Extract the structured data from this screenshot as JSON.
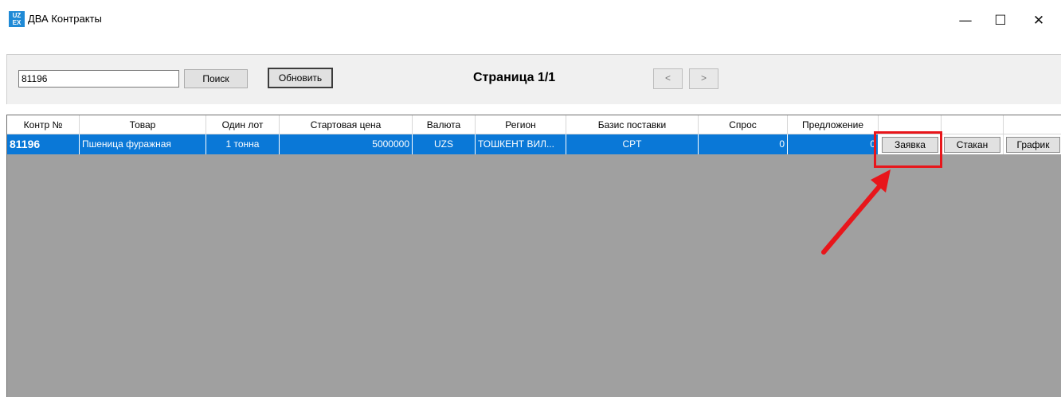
{
  "window": {
    "icon_top": "UZ",
    "icon_bottom": "EX",
    "title": "ДВА Контракты",
    "minimize": "—",
    "maximize": "☐",
    "close": "✕"
  },
  "toolbar": {
    "search_value": "81196",
    "search_label": "Поиск",
    "refresh_label": "Обновить",
    "page_label": "Страница 1/1",
    "prev_label": "<",
    "next_label": ">"
  },
  "table": {
    "headers": [
      "Контр №",
      "Товар",
      "Один лот",
      "Стартовая цена",
      "Валюта",
      "Регион",
      "Базис поставки",
      "Спрос",
      "Предложение",
      "",
      "",
      ""
    ],
    "row": {
      "contract_no": "81196",
      "product": "Пшеница фуражная",
      "lot": "1 тонна",
      "start_price": "5000000",
      "currency": "UZS",
      "region": "ТОШКЕНТ ВИЛ...",
      "delivery_basis": "CPT",
      "demand": "0",
      "offer": "0",
      "order_button": "Заявка",
      "glass_button": "Стакан",
      "chart_button": "График"
    }
  },
  "colors": {
    "selection": "#0a78d7",
    "highlight": "#e8161b",
    "grid_background": "#a0a0a0"
  }
}
